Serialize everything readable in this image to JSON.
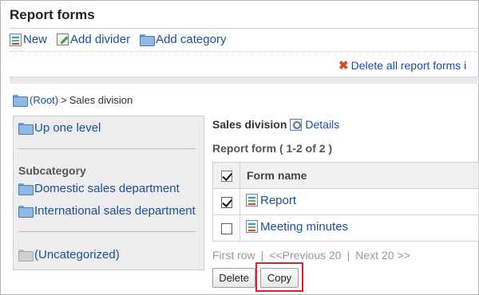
{
  "page": {
    "title": "Report forms"
  },
  "toolbar": {
    "new_label": "New",
    "add_divider_label": "Add divider",
    "add_category_label": "Add category"
  },
  "actions": {
    "delete_all_label": "Delete all report forms i"
  },
  "breadcrumb": {
    "root_label": "(Root)",
    "separator": ">",
    "current": "Sales division"
  },
  "sidebar": {
    "up_level_label": "Up one level",
    "subcategory_heading": "Subcategory",
    "subcategories": [
      "Domestic sales department",
      "International sales department"
    ],
    "uncategorized_label": "(Uncategorized)"
  },
  "main": {
    "category_name": "Sales division",
    "details_label": "Details",
    "count_label": "Report form ( 1-2 of 2 )",
    "column_header": "Form name",
    "rows": [
      {
        "name": "Report",
        "checked": true
      },
      {
        "name": "Meeting minutes",
        "checked": false
      }
    ]
  },
  "pager": {
    "first": "First row",
    "previous": "<<Previous 20",
    "next": "Next 20 >>",
    "divider": "|"
  },
  "buttons": {
    "delete_label": "Delete",
    "copy_label": "Copy"
  },
  "colors": {
    "link": "#1a4fa3",
    "highlight": "#d9232c",
    "delete_icon": "#d24a2a"
  }
}
